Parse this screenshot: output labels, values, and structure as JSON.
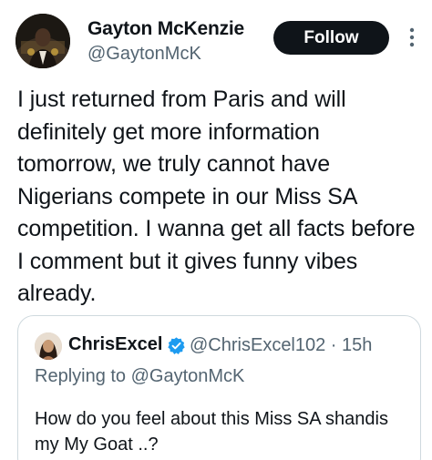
{
  "author": {
    "name": "Gayton McKenzie",
    "handle": "@GaytonMcK",
    "avatar_icon": "profile-photo"
  },
  "follow_label": "Follow",
  "more_icon": "more-vertical-icon",
  "tweet_text": "I just returned from Paris and will definitely get more information tomorrow, we truly cannot have Nigerians compete in our Miss SA competition. I wanna get all facts before I comment but it gives funny vibes already.",
  "quoted": {
    "name": "ChrisExcel",
    "verified_icon": "verified-badge-icon",
    "handle_time": "@ChrisExcel102 · 15h",
    "replying_to": "Replying to @GaytonMcK",
    "text": "How do you feel about this Miss SA shandis my My Goat ..?"
  },
  "colors": {
    "text": "#0f1419",
    "secondary": "#536471",
    "follow_bg": "#0f1419",
    "verified": "#1d9bf0",
    "border": "#cfd9de"
  }
}
